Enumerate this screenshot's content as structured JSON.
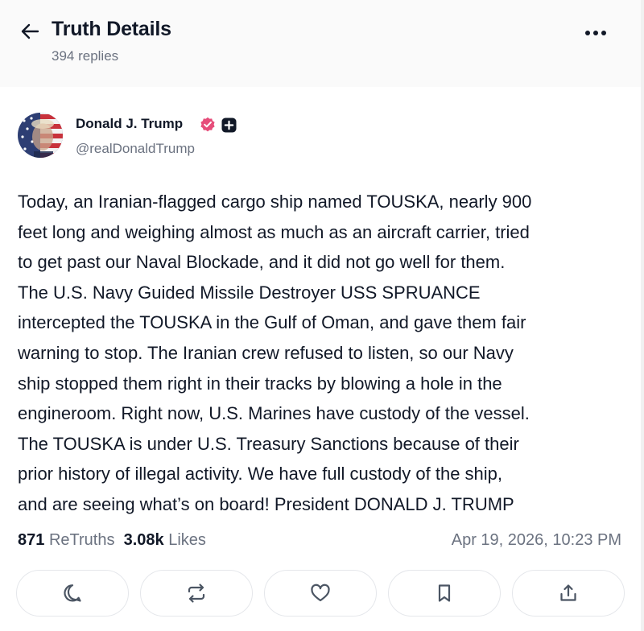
{
  "header": {
    "title": "Truth Details",
    "replies": "394 replies",
    "back_icon": "arrow-left-icon",
    "more_icon": "more-horizontal-icon"
  },
  "post": {
    "author": {
      "name": "Donald J. Trump",
      "handle": "@realDonaldTrump",
      "verified_color": "#e64d7a"
    },
    "text": "Today, an Iranian-flagged cargo ship named TOUSKA, nearly 900\nfeet long and weighing almost as much as an aircraft carrier, tried\nto get past our Naval Blockade, and it did not go well for them.\nThe U.S. Navy Guided Missile Destroyer USS SPRUANCE\nintercepted the TOUSKA in the Gulf of Oman, and gave them fair\nwarning to stop. The Iranian crew refused to listen, so our Navy\nship stopped them right in their tracks by blowing a hole in the\nengineroom. Right now, U.S. Marines have custody of the vessel.\nThe TOUSKA is under U.S. Treasury Sanctions because of their\nprior history of illegal activity. We have full custody of the ship,\nand are seeing what’s on board! President DONALD J. TRUMP",
    "retruths_count": "871",
    "retruths_label": "ReTruths",
    "likes_count": "3.08k",
    "likes_label": "Likes",
    "timestamp": "Apr 19, 2026, 10:23 PM"
  },
  "actions": [
    {
      "icon": "reply-icon"
    },
    {
      "icon": "retruth-icon"
    },
    {
      "icon": "heart-icon"
    },
    {
      "icon": "bookmark-icon"
    },
    {
      "icon": "share-icon"
    }
  ]
}
